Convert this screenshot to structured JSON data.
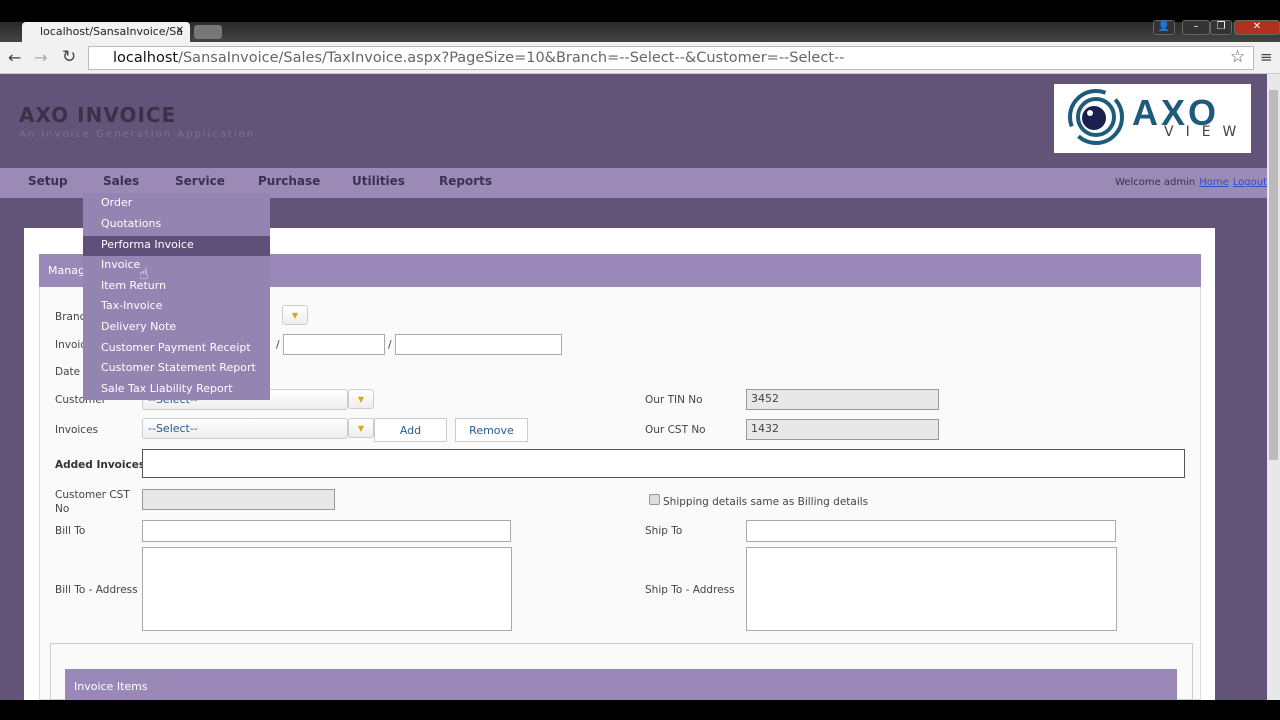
{
  "browser": {
    "tab_title": "localhost/SansaInvoice/Sa",
    "url_host": "localhost",
    "url_path": "/SansaInvoice/Sales/TaxInvoice.aspx?PageSize=10&Branch=--Select--&Customer=--Select--"
  },
  "header": {
    "title": "AXO INVOICE",
    "subtitle": "An Invoice Generation Application",
    "logo_text": "AXO",
    "logo_sub": "VIEW"
  },
  "nav": {
    "items": [
      "Setup",
      "Sales",
      "Service",
      "Purchase",
      "Utilities",
      "Reports"
    ],
    "welcome": "Welcome admin",
    "home": "Home",
    "logout": "Logout"
  },
  "sales_menu": {
    "items": [
      "Order",
      "Quotations",
      "Performa Invoice",
      "Invoice",
      "Item Return",
      "Tax-Invoice",
      "Delivery Note",
      "Customer Payment Receipt",
      "Customer Statement Report",
      "Sale Tax Liability Report"
    ],
    "highlighted": "Performa Invoice"
  },
  "form": {
    "panel_title": "Manag",
    "branch_label": "Branch",
    "invoice_label": "Invoice",
    "date_label": "Date",
    "customer_label": "Customer",
    "customer_select": "--Select--",
    "invoices_label": "Invoices",
    "invoices_select": "--Select--",
    "add": "Add",
    "remove": "Remove",
    "tin_label": "Our TIN No",
    "tin_value": "3452",
    "cst_label": "Our CST No",
    "cst_value": "1432",
    "added_invoices_label": "Added Invoices",
    "customer_cst_label": "Customer CST No",
    "shipping_same": "Shipping details same as Billing details",
    "bill_to": "Bill To",
    "bill_to_address": "Bill To - Address",
    "ship_to": "Ship To",
    "ship_to_address": "Ship To - Address",
    "invoice_items": "Invoice Items"
  },
  "colors": {
    "header": "#625478",
    "nav": "#9a8ab5",
    "menu": "#9484b2",
    "accent": "#9a88b8"
  }
}
